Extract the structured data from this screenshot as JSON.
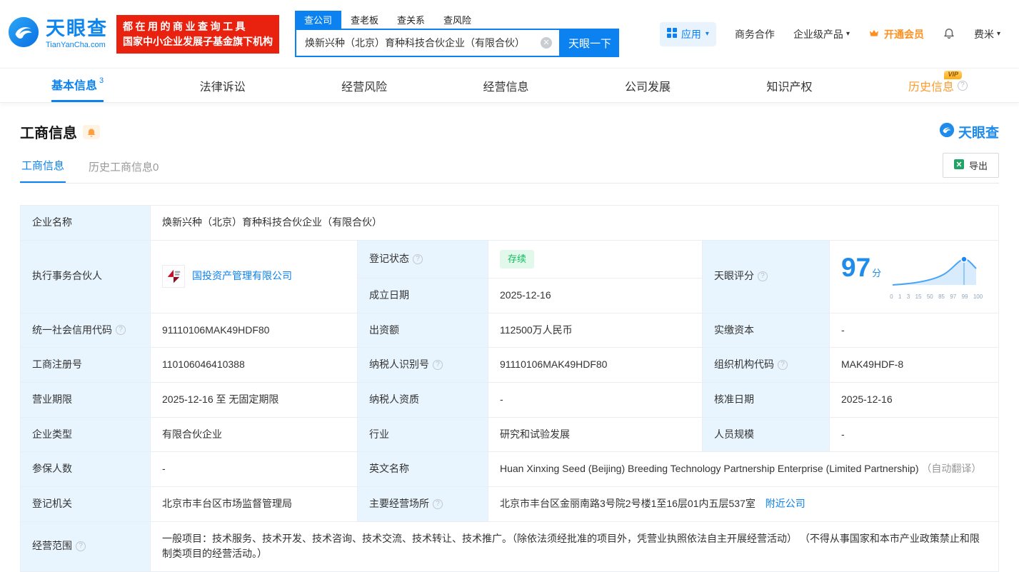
{
  "brand": {
    "name_cn": "天眼查",
    "name_en": "TianYanCha.com"
  },
  "promo": {
    "line1": "都在用的商业查询工具",
    "line2": "国家中小企业发展子基金旗下机构"
  },
  "search": {
    "tabs": [
      {
        "label": "查公司"
      },
      {
        "label": "查老板"
      },
      {
        "label": "查关系"
      },
      {
        "label": "查风险"
      }
    ],
    "value": "焕新兴种（北京）育种科技合伙企业（有限合伙）",
    "button_label": "天眼一下"
  },
  "topnav": {
    "apps": "应用",
    "cooperation": "商务合作",
    "enterprise": "企业级产品",
    "vip": "开通会员",
    "user": "费米"
  },
  "nav_tabs": [
    {
      "label": "基本信息",
      "badge": "3"
    },
    {
      "label": "法律诉讼"
    },
    {
      "label": "经营风险"
    },
    {
      "label": "经营信息"
    },
    {
      "label": "公司发展"
    },
    {
      "label": "知识产权"
    },
    {
      "label": "历史信息",
      "vip": "VIP"
    }
  ],
  "section": {
    "title": "工商信息",
    "brand": "天眼查",
    "subtab_active": "工商信息",
    "subtab_history": "历史工商信息0",
    "export_label": "导出"
  },
  "info": {
    "name_label": "企业名称",
    "name": "焕新兴种（北京）育种科技合伙企业（有限合伙）",
    "partner_label": "执行事务合伙人",
    "partner": "国投资产管理有限公司",
    "status_label": "登记状态",
    "status": "存续",
    "founded_label": "成立日期",
    "founded": "2025-12-16",
    "score_label": "天眼评分",
    "score": "97",
    "score_unit": "分",
    "score_axis": [
      "0",
      "1",
      "3",
      "15",
      "50",
      "85",
      "97",
      "99",
      "100"
    ],
    "credit_code_label": "统一社会信用代码",
    "credit_code": "91110106MAK49HDF80",
    "capital_label": "出资额",
    "capital": "112500万人民币",
    "paidin_label": "实缴资本",
    "paidin": "-",
    "regno_label": "工商注册号",
    "regno": "110106046410388",
    "taxid_label": "纳税人识别号",
    "taxid": "91110106MAK49HDF80",
    "orgcode_label": "组织机构代码",
    "orgcode": "MAK49HDF-8",
    "term_label": "营业期限",
    "term": "2025-12-16 至 无固定期限",
    "taxquality_label": "纳税人资质",
    "taxquality": "-",
    "approval_label": "核准日期",
    "approval": "2025-12-16",
    "type_label": "企业类型",
    "type": "有限合伙企业",
    "industry_label": "行业",
    "industry": "研究和试验发展",
    "staff_label": "人员规模",
    "staff": "-",
    "insured_label": "参保人数",
    "insured": "-",
    "en_name_label": "英文名称",
    "en_name": "Huan Xinxing Seed (Beijing) Breeding Technology Partnership Enterprise (Limited Partnership)",
    "en_name_note": "（自动翻译）",
    "registry_label": "登记机关",
    "registry": "北京市丰台区市场监督管理局",
    "address_label": "主要经营场所",
    "address": "北京市丰台区金丽南路3号院2号楼1至16层01内五层537室",
    "address_link": "附近公司",
    "scope_label": "经营范围",
    "scope": "一般项目：技术服务、技术开发、技术咨询、技术交流、技术转让、技术推广。（除依法须经批准的项目外，凭营业执照依法自主开展经营活动） （不得从事国家和本市产业政策禁止和限制类项目的经营活动。）"
  }
}
